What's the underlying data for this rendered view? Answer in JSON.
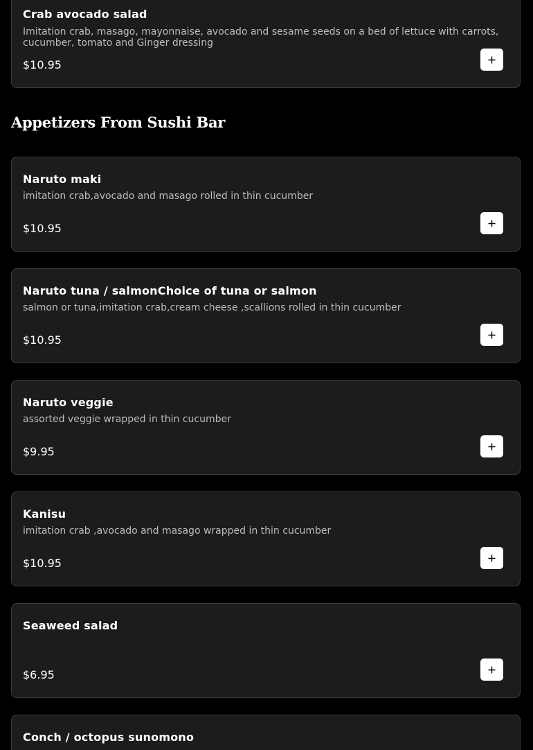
{
  "section": {
    "title": "Appetizers From Sushi Bar"
  },
  "items": [
    {
      "name": "Crab avocado salad",
      "description": "Imitation crab, masago, mayonnaise, avocado and sesame seeds on a bed of lettuce with carrots, cucumber, tomato and Ginger dressing",
      "price": "$10.95"
    },
    {
      "name": "Naruto maki",
      "description": "imitation crab,avocado and masago rolled in thin cucumber",
      "price": "$10.95"
    },
    {
      "name": "Naruto tuna / salmonChoice of tuna or salmon",
      "description": "salmon or tuna,imitation crab,cream cheese ,scallions rolled in thin cucumber",
      "price": "$10.95"
    },
    {
      "name": "Naruto veggie",
      "description": "assorted veggie wrapped in thin cucumber",
      "price": "$9.95"
    },
    {
      "name": "Kanisu",
      "description": "imitation crab ,avocado and masago wrapped in thin cucumber",
      "price": "$10.95"
    },
    {
      "name": "Seaweed salad",
      "description": "",
      "price": "$6.95"
    },
    {
      "name": "Conch / octopus sunomono",
      "description": "",
      "price": ""
    }
  ],
  "icons": {
    "add": "plus-icon"
  },
  "colors": {
    "background": "#000000",
    "card": "#1c1c1c",
    "border": "#3a3a3a",
    "button": "#ffffff"
  }
}
